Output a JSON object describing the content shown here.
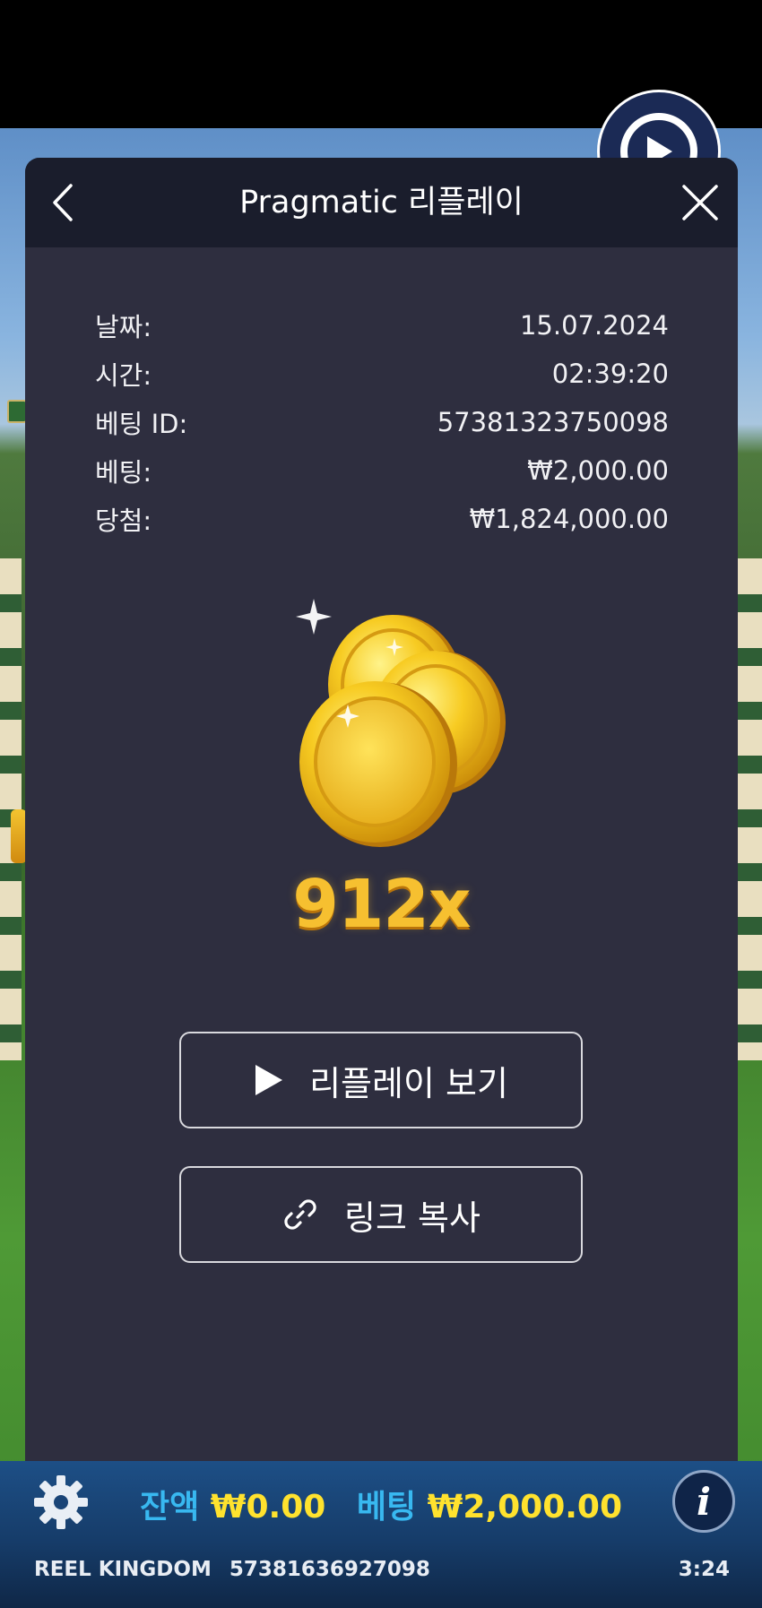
{
  "modal": {
    "title": "Pragmatic 리플레이",
    "rows": [
      {
        "label": "날짜:",
        "value": "15.07.2024"
      },
      {
        "label": "시간:",
        "value": "02:39:20"
      },
      {
        "label": "베팅 ID:",
        "value": "57381323750098"
      },
      {
        "label": "베팅:",
        "value": "₩2,000.00"
      },
      {
        "label": "당첨:",
        "value": "₩1,824,000.00"
      }
    ],
    "multiplier": "912x",
    "watch_replay_label": "리플레이 보기",
    "copy_link_label": "링크 복사"
  },
  "icons": {
    "back": "chevron-left-icon",
    "close": "close-icon",
    "play": "play-icon",
    "link": "link-icon",
    "settings": "gear-icon",
    "info": "info-icon",
    "replay": "replay-icon"
  },
  "status_bar": {
    "balance_label": "잔액",
    "balance_value": "₩0.00",
    "bet_label": "베팅",
    "bet_value": "₩2,000.00",
    "provider": "REEL KINGDOM",
    "session_id": "57381636927098",
    "time": "3:24",
    "info_glyph": "i"
  },
  "colors": {
    "panel": "#2e2e3f",
    "header": "#1a1d2c",
    "multiplier": "#f6c030",
    "balance_label": "#38b8f0",
    "balance_value": "#ffe22e"
  }
}
